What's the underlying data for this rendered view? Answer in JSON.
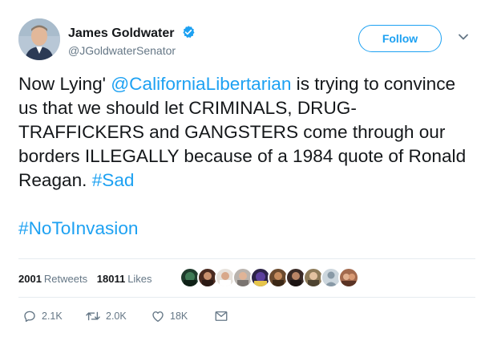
{
  "author": {
    "name": "James Goldwater",
    "handle": "@JGoldwaterSenator"
  },
  "follow_label": "Follow",
  "tweet": {
    "text_before": "Now Lying' ",
    "mention": "@CaliforniaLibertarian",
    "text_middle": " is trying to convince us that we should let CRIMINALS, DRUG-TRAFFICKERS and GANGSTERS come through our borders ILLEGALLY because of a 1984 quote of Ronald Reagan. ",
    "hashtag_inline": "#Sad",
    "hashtag_line": "#NoToInvasion"
  },
  "stats": {
    "retweets_count": "2001",
    "retweets_label": "Retweets",
    "likes_count": "18011",
    "likes_label": "Likes"
  },
  "likers_avatars": [
    "liker-avatar",
    "liker-avatar",
    "liker-avatar",
    "liker-avatar",
    "liker-avatar",
    "liker-avatar",
    "liker-avatar",
    "liker-avatar",
    "liker-avatar",
    "liker-avatar"
  ],
  "actions": {
    "reply_count": "2.1K",
    "retweet_count": "2.0K",
    "like_count": "18K"
  },
  "colors": {
    "link": "#1da1f2",
    "text": "#14171a",
    "muted": "#657786",
    "divider": "#e6ecf0"
  },
  "icons": [
    "verified-badge-icon",
    "chevron-down-icon",
    "reply-icon",
    "retweet-icon",
    "like-icon",
    "message-icon"
  ]
}
